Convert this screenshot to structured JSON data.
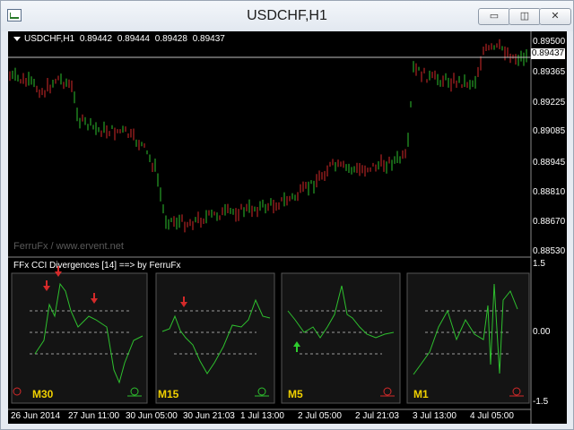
{
  "window": {
    "title": "USDCHF,H1",
    "buttons": [
      {
        "name": "minimize-button",
        "glyph": "▭"
      },
      {
        "name": "restore-button",
        "glyph": "◫"
      },
      {
        "name": "close-button",
        "glyph": "✕"
      }
    ]
  },
  "main_chart": {
    "symbol": "USDCHF,H1",
    "open": "0.89442",
    "high": "0.89444",
    "low": "0.89428",
    "close": "0.89437",
    "current_price_tag": "0.89437",
    "watermark": "FerruFx / www.ervent.net",
    "price_labels": [
      "0.89500",
      "0.89365",
      "0.89225",
      "0.89085",
      "0.88945",
      "0.88810",
      "0.88670",
      "0.88530"
    ],
    "colors": {
      "bull": "#2ec02e",
      "bear": "#d42a2a",
      "grid_line": "#c0c0c0"
    }
  },
  "indicator": {
    "label": "FFx CCI Divergences [14] ==> by FerruFx",
    "scale_labels": [
      "1.5",
      "0.00",
      "-1.5"
    ],
    "panels": [
      {
        "timeframe": "M30",
        "arrows": [
          "down",
          "down",
          "down"
        ]
      },
      {
        "timeframe": "M15",
        "arrows": [
          "down"
        ]
      },
      {
        "timeframe": "M5",
        "arrows": [
          "up"
        ]
      },
      {
        "timeframe": "M1",
        "arrows": []
      }
    ]
  },
  "time_axis": [
    "26 Jun 2014",
    "27 Jun 11:00",
    "30 Jun 05:00",
    "30 Jun 21:03",
    "1 Jul 13:00",
    "2 Jul 05:00",
    "2 Jul 21:03",
    "3 Jul 13:00",
    "4 Jul 05:00"
  ]
}
